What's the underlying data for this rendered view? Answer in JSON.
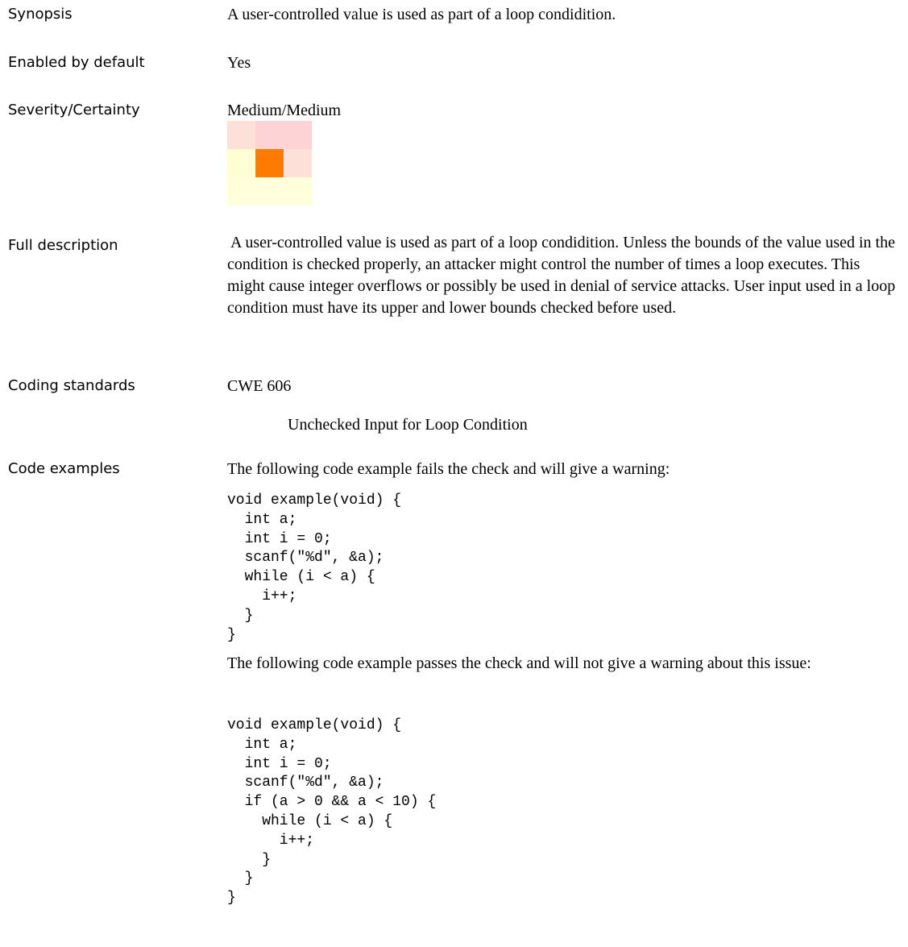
{
  "rows": {
    "synopsis": {
      "label": "Synopsis",
      "value": "A user-controlled value is used as part of a loop condidition."
    },
    "enabled": {
      "label": "Enabled by default",
      "value": "Yes"
    },
    "severity": {
      "label": "Severity/Certainty",
      "value": "Medium/Medium"
    },
    "full_description": {
      "label": "Full description",
      "value": "A user-controlled value is used as part of a loop condidition. Unless the bounds of the value used in the condition is checked properly, an attacker might control the number of times a loop executes. This might cause integer overflows or possibly be used in denial of service attacks.   User input used in a loop condition must have its upper and lower bounds checked before used."
    },
    "coding_standards": {
      "label": "Coding standards",
      "standard": "CWE 606",
      "standard_title": "Unchecked Input for Loop Condition"
    },
    "code_examples": {
      "label": "Code examples",
      "fail_intro": "The following code example fails the check and will give a warning:",
      "fail_code": "void example(void) {\n  int a;\n  int i = 0;\n  scanf(\"%d\", &a);\n  while (i < a) {\n    i++;\n  }\n}",
      "pass_intro": "The following code example passes the check and will not give a warning about this issue:",
      "pass_code": "void example(void) {\n  int a;\n  int i = 0;\n  scanf(\"%d\", &a);\n  if (a > 0 && a < 10) {\n    while (i < a) {\n      i++;\n    }\n  }\n}"
    }
  },
  "severity_matrix": {
    "colors": [
      [
        "#fde0d8",
        "#fdd3d6",
        "#fdd3d6"
      ],
      [
        "#ffffd3",
        "#ff7c00",
        "#fde0d8"
      ],
      [
        "#ffffdb",
        "#ffffdb",
        "#ffffdb"
      ]
    ],
    "highlighted": "Medium/Medium"
  }
}
